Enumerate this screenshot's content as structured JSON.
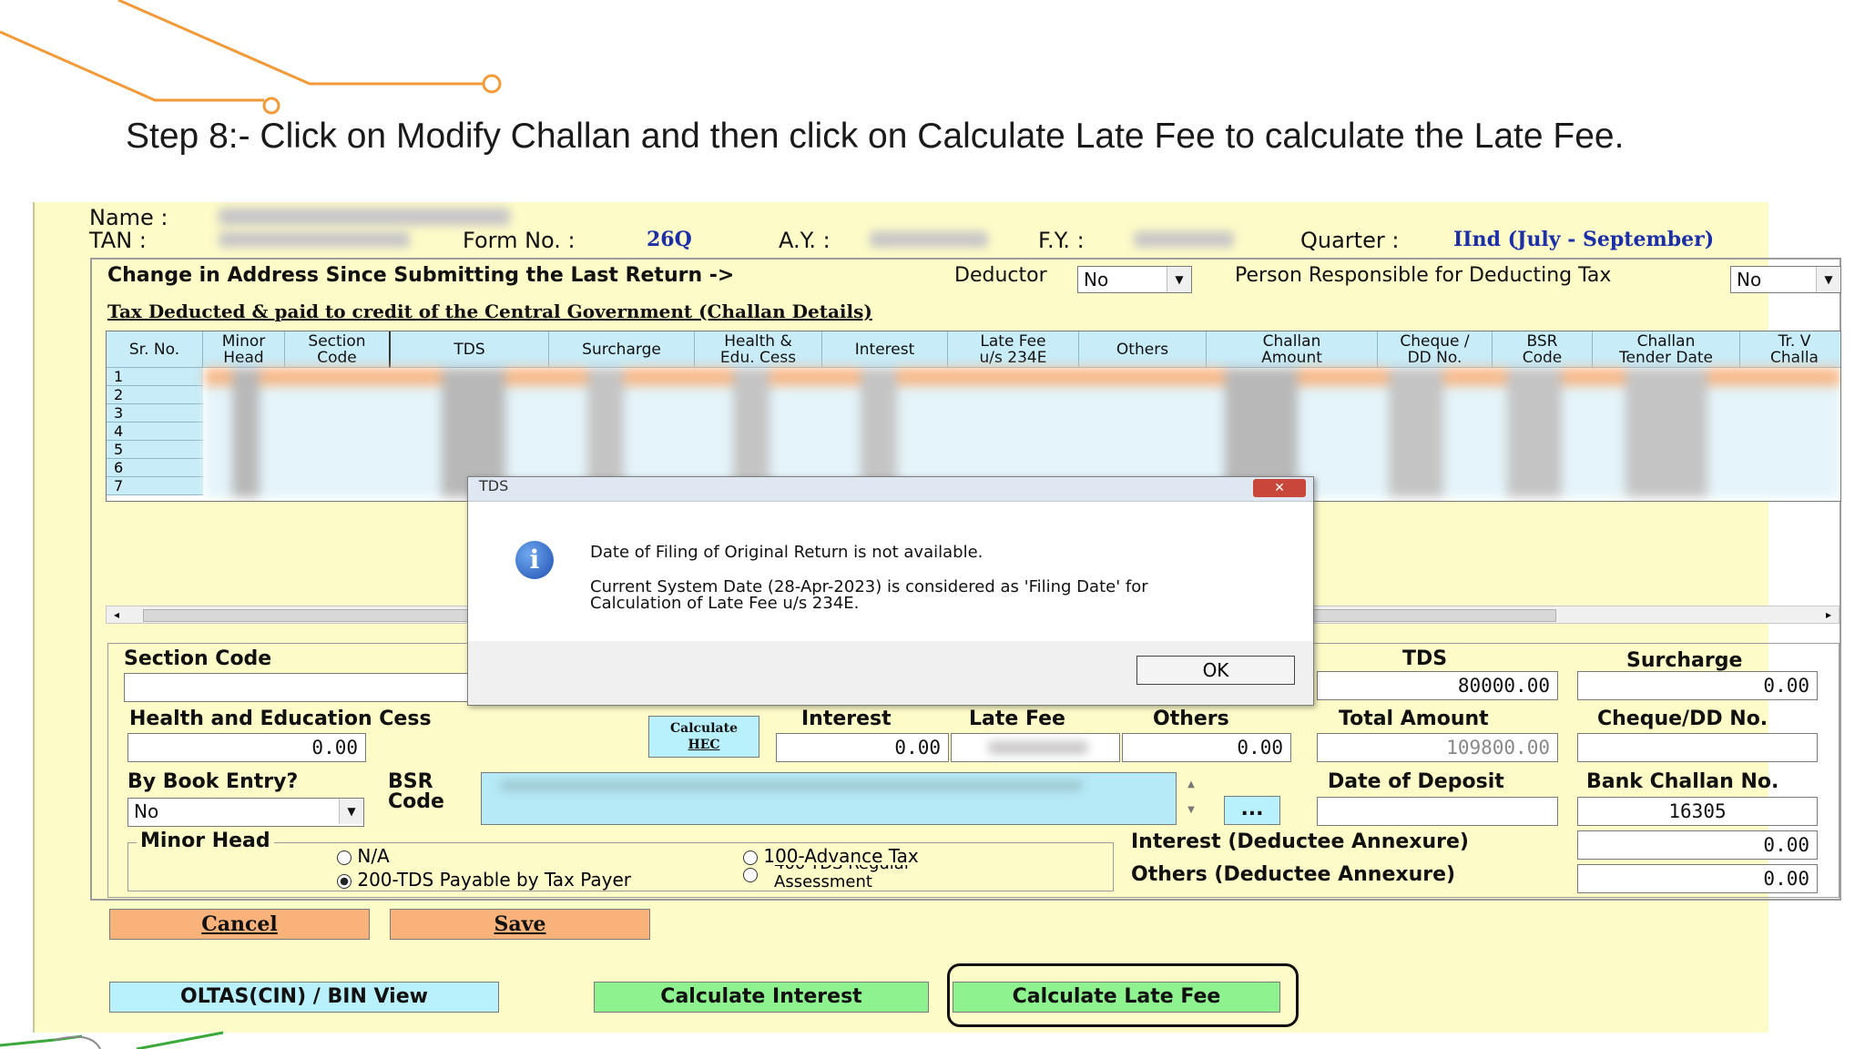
{
  "instruction": "Step 8:- Click on Modify Challan and then click on Calculate Late Fee to calculate the Late Fee.",
  "header": {
    "name_label": "Name :",
    "tan_label": "TAN :",
    "form_no_label": "Form No. :",
    "form_no_value": "26Q",
    "ay_label": "A.Y. :",
    "fy_label": "F.Y. :",
    "quarter_label": "Quarter :",
    "quarter_value": "IInd (July - September)"
  },
  "address_change": {
    "label": "Change in Address Since Submitting the Last Return ->",
    "deductor_label": "Deductor",
    "deductor_value": "No",
    "responsible_label": "Person Responsible for Deducting Tax",
    "responsible_value": "No"
  },
  "section_title": "Tax Deducted & paid to credit of the Central Government (Challan Details)",
  "table": {
    "columns": [
      "Sr. No.",
      "Minor\nHead",
      "Section\nCode",
      "TDS",
      "Surcharge",
      "Health &\nEdu. Cess",
      "Interest",
      "Late Fee\nu/s 234E",
      "Others",
      "Challan\nAmount",
      "Cheque /\nDD No.",
      "BSR\nCode",
      "Challan\nTender Date",
      "Tr. V\nChalla"
    ],
    "rows": [
      "1",
      "2",
      "3",
      "4",
      "5",
      "6",
      "7"
    ]
  },
  "dialog": {
    "title": "TDS",
    "message_line1": "Date of Filing of Original Return is not available.",
    "message_line2": "Current System Date (28-Apr-2023) is considered as 'Filing Date' for",
    "message_line3": "Calculation of Late Fee u/s 234E.",
    "ok_label": "OK",
    "icon": "info-icon"
  },
  "fields": {
    "section_code_label": "Section Code",
    "tds_label": "TDS",
    "tds_value": "80000.00",
    "surcharge_label": "Surcharge",
    "surcharge_value": "0.00",
    "hec_label": "Health and Education Cess",
    "hec_value": "0.00",
    "calc_hec_line1": "Calculate",
    "calc_hec_line2": "HEC",
    "interest_label": "Interest",
    "interest_value": "0.00",
    "late_fee_label": "Late Fee",
    "others_label": "Others",
    "others_value": "0.00",
    "total_amount_label": "Total Amount",
    "total_amount_value": "109800.00",
    "cheque_label": "Cheque/DD No.",
    "book_entry_label": "By Book Entry?",
    "book_entry_value": "No",
    "bsr_label_1": "BSR",
    "bsr_label_2": "Code",
    "browse_label": "...",
    "date_of_deposit_label": "Date of Deposit",
    "bank_challan_label": "Bank Challan No.",
    "bank_challan_value": "16305",
    "minor_head_label": "Minor Head",
    "radio_na": "N/A",
    "radio_200": "200-TDS Payable by Tax Payer",
    "radio_100": "100-Advance Tax",
    "radio_400_1": "400-TDS Regular",
    "radio_400_2": "Assessment",
    "interest_annex_label": "Interest (Deductee Annexure)",
    "interest_annex_value": "0.00",
    "others_annex_label": "Others (Deductee Annexure)",
    "others_annex_value": "0.00"
  },
  "buttons": {
    "cancel": "Cancel",
    "save": "Save",
    "oltas": "OLTAS(CIN) / BIN View",
    "calc_interest": "Calculate Interest",
    "calc_late_fee": "Calculate Late Fee"
  },
  "colors": {
    "panel_bg": "#fdfbc8",
    "orange_button": "#f9b27a",
    "green_button": "#8ef28e",
    "cyan_button": "#b8f0fb",
    "header_cyan": "#c8ecf8",
    "selected_row": "#f6b98a",
    "decor_orange": "#f29a38",
    "decor_green": "#3aa83a"
  }
}
